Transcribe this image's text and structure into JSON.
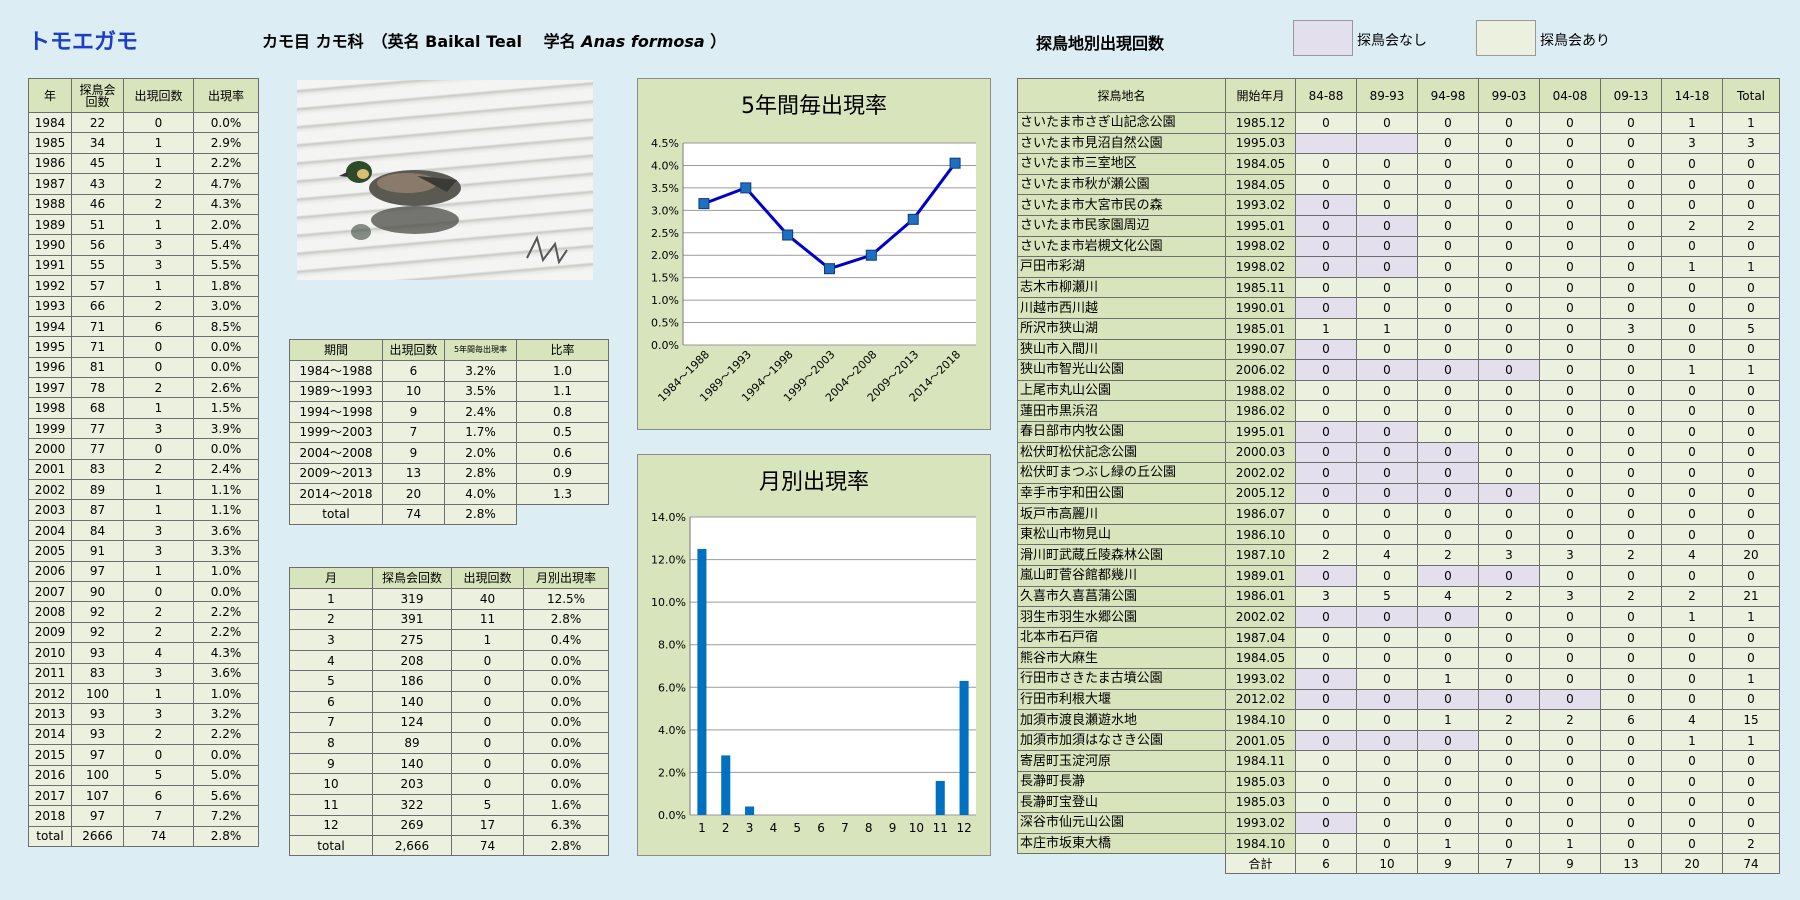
{
  "header": {
    "species": "トモエガモ",
    "taxon_prefix": "カモ目 カモ科　（英名 Baikal Teal　 学名 ",
    "scientific": "Anas formosa",
    "taxon_suffix": " ）",
    "site_title": "探鳥地別出現回数",
    "legend_none_label": "探鳥会なし",
    "legend_some_label": "探鳥会あり",
    "legend_none_color": "#e4dfec",
    "legend_some_color": "#ebf1de"
  },
  "yearly": {
    "headers": [
      "年",
      "探鳥会\n回数",
      "出現回数",
      "出現率"
    ],
    "rows": [
      [
        "1984",
        "22",
        "0",
        "0.0%"
      ],
      [
        "1985",
        "34",
        "1",
        "2.9%"
      ],
      [
        "1986",
        "45",
        "1",
        "2.2%"
      ],
      [
        "1987",
        "43",
        "2",
        "4.7%"
      ],
      [
        "1988",
        "46",
        "2",
        "4.3%"
      ],
      [
        "1989",
        "51",
        "1",
        "2.0%"
      ],
      [
        "1990",
        "56",
        "3",
        "5.4%"
      ],
      [
        "1991",
        "55",
        "3",
        "5.5%"
      ],
      [
        "1992",
        "57",
        "1",
        "1.8%"
      ],
      [
        "1993",
        "66",
        "2",
        "3.0%"
      ],
      [
        "1994",
        "71",
        "6",
        "8.5%"
      ],
      [
        "1995",
        "71",
        "0",
        "0.0%"
      ],
      [
        "1996",
        "81",
        "0",
        "0.0%"
      ],
      [
        "1997",
        "78",
        "2",
        "2.6%"
      ],
      [
        "1998",
        "68",
        "1",
        "1.5%"
      ],
      [
        "1999",
        "77",
        "3",
        "3.9%"
      ],
      [
        "2000",
        "77",
        "0",
        "0.0%"
      ],
      [
        "2001",
        "83",
        "2",
        "2.4%"
      ],
      [
        "2002",
        "89",
        "1",
        "1.1%"
      ],
      [
        "2003",
        "87",
        "1",
        "1.1%"
      ],
      [
        "2004",
        "84",
        "3",
        "3.6%"
      ],
      [
        "2005",
        "91",
        "3",
        "3.3%"
      ],
      [
        "2006",
        "97",
        "1",
        "1.0%"
      ],
      [
        "2007",
        "90",
        "0",
        "0.0%"
      ],
      [
        "2008",
        "92",
        "2",
        "2.2%"
      ],
      [
        "2009",
        "92",
        "2",
        "2.2%"
      ],
      [
        "2010",
        "93",
        "4",
        "4.3%"
      ],
      [
        "2011",
        "83",
        "3",
        "3.6%"
      ],
      [
        "2012",
        "100",
        "1",
        "1.0%"
      ],
      [
        "2013",
        "93",
        "3",
        "3.2%"
      ],
      [
        "2014",
        "93",
        "2",
        "2.2%"
      ],
      [
        "2015",
        "97",
        "0",
        "0.0%"
      ],
      [
        "2016",
        "100",
        "5",
        "5.0%"
      ],
      [
        "2017",
        "107",
        "6",
        "5.6%"
      ],
      [
        "2018",
        "97",
        "7",
        "7.2%"
      ]
    ],
    "total": [
      "total",
      "2666",
      "74",
      "2.8%"
    ]
  },
  "period_table": {
    "headers": [
      "期間",
      "出現回数",
      "5年間毎出現率",
      "比率"
    ],
    "rows": [
      [
        "1984～1988",
        "6",
        "3.2%",
        "1.0"
      ],
      [
        "1989～1993",
        "10",
        "3.5%",
        "1.1"
      ],
      [
        "1994～1998",
        "9",
        "2.4%",
        "0.8"
      ],
      [
        "1999～2003",
        "7",
        "1.7%",
        "0.5"
      ],
      [
        "2004～2008",
        "9",
        "2.0%",
        "0.6"
      ],
      [
        "2009～2013",
        "13",
        "2.8%",
        "0.9"
      ],
      [
        "2014～2018",
        "20",
        "4.0%",
        "1.3"
      ]
    ],
    "total": [
      "total",
      "74",
      "2.8%"
    ]
  },
  "monthly_table": {
    "headers": [
      "月",
      "探鳥会回数",
      "出現回数",
      "月別出現率"
    ],
    "rows": [
      [
        "1",
        "319",
        "40",
        "12.5%"
      ],
      [
        "2",
        "391",
        "11",
        "2.8%"
      ],
      [
        "3",
        "275",
        "1",
        "0.4%"
      ],
      [
        "4",
        "208",
        "0",
        "0.0%"
      ],
      [
        "5",
        "186",
        "0",
        "0.0%"
      ],
      [
        "6",
        "140",
        "0",
        "0.0%"
      ],
      [
        "7",
        "124",
        "0",
        "0.0%"
      ],
      [
        "8",
        "89",
        "0",
        "0.0%"
      ],
      [
        "9",
        "140",
        "0",
        "0.0%"
      ],
      [
        "10",
        "203",
        "0",
        "0.0%"
      ],
      [
        "11",
        "322",
        "5",
        "1.6%"
      ],
      [
        "12",
        "269",
        "17",
        "6.3%"
      ]
    ],
    "total": [
      "total",
      "2,666",
      "74",
      "2.8%"
    ]
  },
  "sites": {
    "headers": [
      "探鳥地名",
      "開始年月",
      "84-88",
      "89-93",
      "94-98",
      "99-03",
      "04-08",
      "09-13",
      "14-18",
      "Total"
    ],
    "rows": [
      {
        "name": "さいたま市さぎ山記念公園",
        "start": "1985.12",
        "vals": [
          "0",
          "0",
          "0",
          "0",
          "0",
          "0",
          "1",
          "1"
        ],
        "none": []
      },
      {
        "name": "さいたま市見沼自然公園",
        "start": "1995.03",
        "vals": [
          "",
          "",
          "0",
          "0",
          "0",
          "0",
          "3",
          "3"
        ],
        "none": [
          0,
          1
        ]
      },
      {
        "name": "さいたま市三室地区",
        "start": "1984.05",
        "vals": [
          "0",
          "0",
          "0",
          "0",
          "0",
          "0",
          "0",
          "0"
        ],
        "none": []
      },
      {
        "name": "さいたま市秋が瀬公園",
        "start": "1984.05",
        "vals": [
          "0",
          "0",
          "0",
          "0",
          "0",
          "0",
          "0",
          "0"
        ],
        "none": []
      },
      {
        "name": "さいたま市大宮市民の森",
        "start": "1993.02",
        "vals": [
          "0",
          "0",
          "0",
          "0",
          "0",
          "0",
          "0",
          "0"
        ],
        "none": [
          0
        ]
      },
      {
        "name": "さいたま市民家園周辺",
        "start": "1995.01",
        "vals": [
          "0",
          "0",
          "0",
          "0",
          "0",
          "0",
          "2",
          "2"
        ],
        "none": [
          0,
          1
        ]
      },
      {
        "name": "さいたま市岩槻文化公園",
        "start": "1998.02",
        "vals": [
          "0",
          "0",
          "0",
          "0",
          "0",
          "0",
          "0",
          "0"
        ],
        "none": [
          0,
          1
        ]
      },
      {
        "name": "戸田市彩湖",
        "start": "1998.02",
        "vals": [
          "0",
          "0",
          "0",
          "0",
          "0",
          "0",
          "1",
          "1"
        ],
        "none": [
          0,
          1
        ]
      },
      {
        "name": "志木市柳瀬川",
        "start": "1985.11",
        "vals": [
          "0",
          "0",
          "0",
          "0",
          "0",
          "0",
          "0",
          "0"
        ],
        "none": []
      },
      {
        "name": "川越市西川越",
        "start": "1990.01",
        "vals": [
          "0",
          "0",
          "0",
          "0",
          "0",
          "0",
          "0",
          "0"
        ],
        "none": [
          0
        ]
      },
      {
        "name": "所沢市狭山湖",
        "start": "1985.01",
        "vals": [
          "1",
          "1",
          "0",
          "0",
          "0",
          "3",
          "0",
          "5"
        ],
        "none": []
      },
      {
        "name": "狭山市入間川",
        "start": "1990.07",
        "vals": [
          "0",
          "0",
          "0",
          "0",
          "0",
          "0",
          "0",
          "0"
        ],
        "none": [
          0
        ]
      },
      {
        "name": "狭山市智光山公園",
        "start": "2006.02",
        "vals": [
          "0",
          "0",
          "0",
          "0",
          "0",
          "0",
          "1",
          "1"
        ],
        "none": [
          0,
          1,
          2,
          3
        ]
      },
      {
        "name": "上尾市丸山公園",
        "start": "1988.02",
        "vals": [
          "0",
          "0",
          "0",
          "0",
          "0",
          "0",
          "0",
          "0"
        ],
        "none": []
      },
      {
        "name": "蓮田市黒浜沼",
        "start": "1986.02",
        "vals": [
          "0",
          "0",
          "0",
          "0",
          "0",
          "0",
          "0",
          "0"
        ],
        "none": []
      },
      {
        "name": "春日部市内牧公園",
        "start": "1995.01",
        "vals": [
          "0",
          "0",
          "0",
          "0",
          "0",
          "0",
          "0",
          "0"
        ],
        "none": [
          0,
          1
        ]
      },
      {
        "name": "松伏町松伏記念公園",
        "start": "2000.03",
        "vals": [
          "0",
          "0",
          "0",
          "0",
          "0",
          "0",
          "0",
          "0"
        ],
        "none": [
          0,
          1,
          2
        ]
      },
      {
        "name": "松伏町まつぶし緑の丘公園",
        "start": "2002.02",
        "vals": [
          "0",
          "0",
          "0",
          "0",
          "0",
          "0",
          "0",
          "0"
        ],
        "none": [
          0,
          1,
          2
        ]
      },
      {
        "name": "幸手市宇和田公園",
        "start": "2005.12",
        "vals": [
          "0",
          "0",
          "0",
          "0",
          "0",
          "0",
          "0",
          "0"
        ],
        "none": [
          0,
          1,
          2,
          3
        ]
      },
      {
        "name": "坂戸市高麗川",
        "start": "1986.07",
        "vals": [
          "0",
          "0",
          "0",
          "0",
          "0",
          "0",
          "0",
          "0"
        ],
        "none": []
      },
      {
        "name": "東松山市物見山",
        "start": "1986.10",
        "vals": [
          "0",
          "0",
          "0",
          "0",
          "0",
          "0",
          "0",
          "0"
        ],
        "none": []
      },
      {
        "name": "滑川町武蔵丘陵森林公園",
        "start": "1987.10",
        "vals": [
          "2",
          "4",
          "2",
          "3",
          "3",
          "2",
          "4",
          "20"
        ],
        "none": []
      },
      {
        "name": "嵐山町菅谷館都幾川",
        "start": "1989.01",
        "vals": [
          "0",
          "0",
          "0",
          "0",
          "0",
          "0",
          "0",
          "0"
        ],
        "none": [
          0,
          2,
          3
        ]
      },
      {
        "name": "久喜市久喜菖蒲公園",
        "start": "1986.01",
        "vals": [
          "3",
          "5",
          "4",
          "2",
          "3",
          "2",
          "2",
          "21"
        ],
        "none": []
      },
      {
        "name": "羽生市羽生水郷公園",
        "start": "2002.02",
        "vals": [
          "0",
          "0",
          "0",
          "0",
          "0",
          "0",
          "1",
          "1"
        ],
        "none": [
          0,
          1,
          2
        ]
      },
      {
        "name": "北本市石戸宿",
        "start": "1987.04",
        "vals": [
          "0",
          "0",
          "0",
          "0",
          "0",
          "0",
          "0",
          "0"
        ],
        "none": []
      },
      {
        "name": "熊谷市大麻生",
        "start": "1984.05",
        "vals": [
          "0",
          "0",
          "0",
          "0",
          "0",
          "0",
          "0",
          "0"
        ],
        "none": []
      },
      {
        "name": "行田市さきたま古墳公園",
        "start": "1993.02",
        "vals": [
          "0",
          "0",
          "1",
          "0",
          "0",
          "0",
          "0",
          "1"
        ],
        "none": [
          0
        ]
      },
      {
        "name": "行田市利根大堰",
        "start": "2012.02",
        "vals": [
          "0",
          "0",
          "0",
          "0",
          "0",
          "0",
          "0",
          "0"
        ],
        "none": [
          0,
          1,
          2,
          3,
          4
        ]
      },
      {
        "name": "加須市渡良瀬遊水地",
        "start": "1984.10",
        "vals": [
          "0",
          "0",
          "1",
          "2",
          "2",
          "6",
          "4",
          "15"
        ],
        "none": []
      },
      {
        "name": "加須市加須はなさき公園",
        "start": "2001.05",
        "vals": [
          "0",
          "0",
          "0",
          "0",
          "0",
          "0",
          "1",
          "1"
        ],
        "none": [
          0,
          1,
          2
        ]
      },
      {
        "name": "寄居町玉淀河原",
        "start": "1984.11",
        "vals": [
          "0",
          "0",
          "0",
          "0",
          "0",
          "0",
          "0",
          "0"
        ],
        "none": []
      },
      {
        "name": "長瀞町長瀞",
        "start": "1985.03",
        "vals": [
          "0",
          "0",
          "0",
          "0",
          "0",
          "0",
          "0",
          "0"
        ],
        "none": []
      },
      {
        "name": "長瀞町宝登山",
        "start": "1985.03",
        "vals": [
          "0",
          "0",
          "0",
          "0",
          "0",
          "0",
          "0",
          "0"
        ],
        "none": []
      },
      {
        "name": "深谷市仙元山公園",
        "start": "1993.02",
        "vals": [
          "0",
          "0",
          "0",
          "0",
          "0",
          "0",
          "0",
          "0"
        ],
        "none": [
          0
        ]
      },
      {
        "name": "本庄市坂東大橋",
        "start": "1984.10",
        "vals": [
          "0",
          "0",
          "1",
          "0",
          "1",
          "0",
          "0",
          "2"
        ],
        "none": []
      }
    ],
    "total_label": "合計",
    "totals": [
      "6",
      "10",
      "9",
      "7",
      "9",
      "13",
      "20",
      "74"
    ]
  },
  "chart_data": [
    {
      "type": "line",
      "title": "5年間毎出現率",
      "categories": [
        "1984～1988",
        "1989～1993",
        "1994～1998",
        "1999～2003",
        "2004～2008",
        "2009～2013",
        "2014～2018"
      ],
      "values": [
        3.15,
        3.5,
        2.45,
        1.7,
        2.0,
        2.8,
        4.05
      ],
      "y_ticks": [
        "0.0%",
        "0.5%",
        "1.0%",
        "1.5%",
        "2.0%",
        "2.5%",
        "3.0%",
        "3.5%",
        "4.0%",
        "4.5%"
      ],
      "ylim": [
        0,
        4.5
      ],
      "grid": true,
      "color": "#0000cc",
      "marker_color": "#1f6fc0"
    },
    {
      "type": "bar",
      "title": "月別出現率",
      "categories": [
        "1",
        "2",
        "3",
        "4",
        "5",
        "6",
        "7",
        "8",
        "9",
        "10",
        "11",
        "12"
      ],
      "values": [
        12.5,
        2.8,
        0.4,
        0,
        0,
        0,
        0,
        0,
        0,
        0,
        1.6,
        6.3
      ],
      "y_ticks": [
        "0.0%",
        "2.0%",
        "4.0%",
        "6.0%",
        "8.0%",
        "10.0%",
        "12.0%",
        "14.0%"
      ],
      "ylim": [
        0,
        14
      ],
      "grid": true,
      "color": "#0070c0"
    }
  ]
}
